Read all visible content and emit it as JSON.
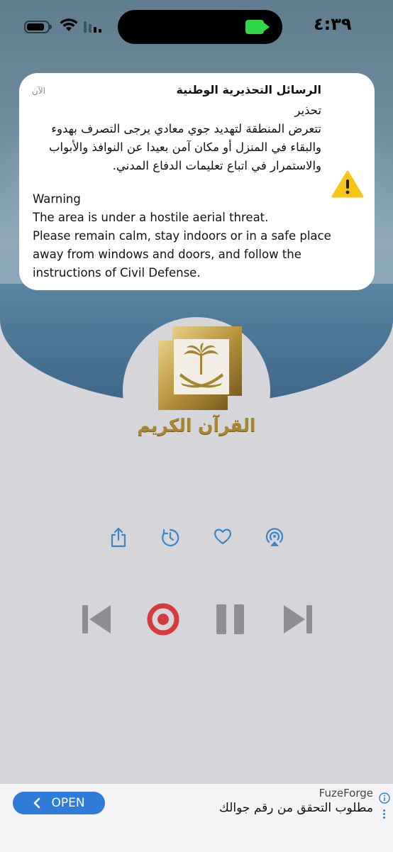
{
  "status_bar": {
    "time": "٤:٣٩",
    "battery_level": 0.7,
    "camera_active": true
  },
  "notification": {
    "app_title": "الرسائل التحذيرية الوطنية",
    "time": "الآن",
    "arabic_heading": "تحذير",
    "arabic_body": [
      "تتعرض المنطقة لتهديد جوي معادي يرجى التصرف بهدوء",
      "والبقاء في المنزل أو مكان آمن بعيدا عن النوافذ والأبواب",
      "والاستمرار في اتباع تعليمات الدفاع المدني."
    ],
    "english_heading": "Warning",
    "english_body": [
      "The area is under a hostile aerial threat.",
      "Please remain calm, stay indoors or in a safe place",
      "away from windows and doors, and follow the",
      "instructions of Civil Defense."
    ],
    "icon": "warning-triangle-icon",
    "icon_color": "#f5c518"
  },
  "player": {
    "logo_text": "القرآن الكريم",
    "accent": "#3a86c8",
    "record_color": "#d63b3b",
    "actions": [
      "share-icon",
      "timer-icon",
      "heart-icon",
      "airplay-icon"
    ],
    "controls": [
      "previous-icon",
      "record-button",
      "pause-icon",
      "next-icon"
    ]
  },
  "ad": {
    "button_label": "OPEN",
    "brand": "FuzeForge",
    "text": "مطلوب التحقق من رقم جوالك",
    "button_color": "#2f7bd8"
  }
}
